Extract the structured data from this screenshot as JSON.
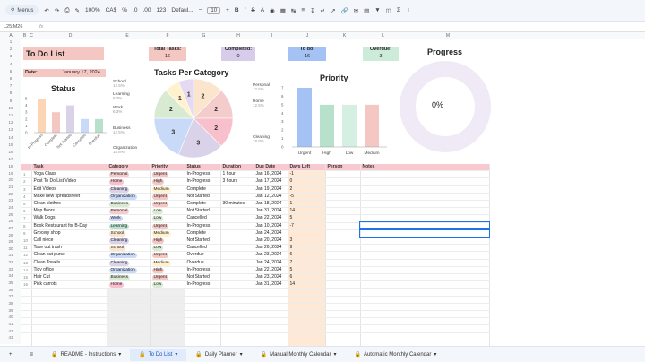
{
  "toolbar": {
    "menus": "Menus",
    "zoom": "100%",
    "currency": "CA$",
    "pct": "%",
    "dec": ".0",
    "dec2": ".00",
    "fmt": "123",
    "font": "Defaul...",
    "size": "10"
  },
  "formula_bar": {
    "cell_ref": "L25:M26",
    "fx": "fx"
  },
  "columns": [
    "A",
    "B",
    "C",
    "D",
    "E",
    "F",
    "G",
    "H",
    "I",
    "J",
    "K",
    "L",
    "M"
  ],
  "rows": [
    "1",
    "2",
    "3",
    "4",
    "5",
    "6",
    "7",
    "8",
    "9",
    "10",
    "11",
    "12",
    "13",
    "14",
    "15",
    "16",
    "17",
    "18",
    "19",
    "20",
    "21",
    "22",
    "23",
    "24",
    "25",
    "26",
    "27",
    "28",
    "29",
    "30",
    "31",
    "32",
    "33",
    "34",
    "35",
    "36",
    "37",
    "38",
    "39",
    "40",
    "41",
    "42",
    "43",
    "44",
    "45",
    "46",
    "47",
    "48",
    "49"
  ],
  "header": {
    "title": "To Do List",
    "date_label": "Date:",
    "date_value": "January 17, 2024"
  },
  "kpis": [
    {
      "label": "Total Tasks:",
      "value": "16",
      "color": "#f4c7c3"
    },
    {
      "label": "Completed:",
      "value": "0",
      "color": "#d7cdea"
    },
    {
      "label": "To do:",
      "value": "16",
      "color": "#a4c2f4"
    },
    {
      "label": "Overdue:",
      "value": "3",
      "color": "#cdebd9"
    }
  ],
  "status_chart": {
    "title": "Status",
    "yticks": [
      "5",
      "4",
      "3",
      "2",
      "1",
      "0"
    ],
    "categories": [
      "In-Progress",
      "Complete",
      "Not Started",
      "Cancelled",
      "Overdue"
    ],
    "values": [
      5,
      3,
      4,
      2,
      2
    ],
    "colors": [
      "#fcd5b4",
      "#f4c7c3",
      "#d9d2e9",
      "#c9daf8",
      "#b7e1cd"
    ]
  },
  "category_chart": {
    "title": "Tasks Per Category",
    "slices": [
      {
        "name": "School",
        "pct": "12.5%",
        "value": 2,
        "color": "#fce5cd"
      },
      {
        "name": "Personal",
        "pct": "12.5%",
        "value": 2,
        "color": "#f4cccc"
      },
      {
        "name": "Home",
        "pct": "12.5%",
        "value": 2,
        "color": "#f8c0cc"
      },
      {
        "name": "Cleaning",
        "pct": "18.8%",
        "value": 3,
        "color": "#d9d2e9"
      },
      {
        "name": "Organization",
        "pct": "18.8%",
        "value": 3,
        "color": "#c9daf8"
      },
      {
        "name": "Business",
        "pct": "12.5%",
        "value": 2,
        "color": "#d9ead3"
      },
      {
        "name": "Work",
        "pct": "6.3%",
        "value": 1,
        "color": "#fff2cc"
      },
      {
        "name": "Learning",
        "pct": "6.3%",
        "value": 1,
        "color": "#e6d9f2"
      }
    ]
  },
  "priority_chart": {
    "title": "Priority",
    "yticks": [
      "7",
      "6",
      "5",
      "4",
      "3",
      "2",
      "1",
      "0"
    ],
    "categories": [
      "Urgent",
      "High",
      "Low",
      "Medium"
    ],
    "values": [
      7,
      5,
      5,
      5
    ],
    "colors": [
      "#a4c2f4",
      "#b7e1cd",
      "#d5f0e3",
      "#f4c7c3"
    ]
  },
  "progress": {
    "title": "Progress",
    "value": "0%",
    "fraction": 0
  },
  "table": {
    "headers": [
      "Task",
      "Category",
      "Priority",
      "Status",
      "Duration",
      "Due Date",
      "Days Left",
      "Person",
      "Notes"
    ],
    "rows": [
      [
        "Yoga Class",
        "Personal",
        "Urgent",
        "In-Progress",
        "1 hour",
        "Jan 16, 2024",
        "-1",
        "",
        ""
      ],
      [
        "Post To Do List Video",
        "Home",
        "High",
        "In-Progress",
        "3 hours",
        "Jan 17, 2024",
        "0",
        "",
        ""
      ],
      [
        "Edit Videos",
        "Cleaning",
        "Medium",
        "Complete",
        "",
        "Jan 19, 2024",
        "2",
        "",
        ""
      ],
      [
        "Make new spreadsheet",
        "Organization",
        "Urgent",
        "Not Started",
        "",
        "Jan 12, 2024",
        "-5",
        "",
        ""
      ],
      [
        "Clean clothes",
        "Business",
        "Urgent",
        "Complete",
        "30 minutes",
        "Jan 18, 2024",
        "1",
        "",
        ""
      ],
      [
        "Mop floors",
        "Personal",
        "Low",
        "Not Started",
        "",
        "Jan 31, 2024",
        "14",
        "",
        ""
      ],
      [
        "Walk Dogs",
        "Work",
        "Low",
        "Cancelled",
        "",
        "Jan 22, 2024",
        "5",
        "",
        ""
      ],
      [
        "Book Restaurant for B-Day",
        "Learning",
        "Urgent",
        "In-Progress",
        "",
        "Jan 10, 2024",
        "-7",
        "",
        ""
      ],
      [
        "Grocery shop",
        "School",
        "Medium",
        "Complete",
        "",
        "Jan 24, 2024",
        "",
        "",
        ""
      ],
      [
        "Call niece",
        "Cleaning",
        "High",
        "Not Started",
        "",
        "Jan 20, 2024",
        "3",
        "",
        ""
      ],
      [
        "Take out trash",
        "School",
        "Low",
        "Cancelled",
        "",
        "Jan 26, 2024",
        "9",
        "",
        ""
      ],
      [
        "Clean out purse",
        "Organization",
        "Urgent",
        "Overdue",
        "",
        "Jan 23, 2024",
        "6",
        "",
        ""
      ],
      [
        "Clean Towels",
        "Cleaning",
        "Medium",
        "Overdue",
        "",
        "Jan 24, 2024",
        "7",
        "",
        ""
      ],
      [
        "Tidy office",
        "Organization",
        "High",
        "In-Progress",
        "",
        "Jan 22, 2024",
        "5",
        "",
        ""
      ],
      [
        "Hair Cut",
        "Business",
        "Urgent",
        "Not Started",
        "",
        "Jan 23, 2024",
        "6",
        "",
        ""
      ],
      [
        "Pick carrots",
        "Home",
        "Low",
        "In-Progress",
        "",
        "Jan 31, 2024",
        "14",
        "",
        ""
      ]
    ],
    "row_numbers": [
      "1",
      "2",
      "3",
      "4",
      "5",
      "6",
      "7",
      "8",
      "9",
      "10",
      "11",
      "12",
      "13",
      "14",
      "15",
      "16"
    ],
    "empty_rows": 9
  },
  "category_colors": {
    "Personal": "#f4cccc",
    "Home": "#f8c0cc",
    "Cleaning": "#d9d2e9",
    "Organization": "#c9daf8",
    "Business": "#d9ead3",
    "Work": "#c9daf8",
    "Learning": "#b7e1cd",
    "School": "#fce5cd"
  },
  "priority_colors": {
    "Urgent": "#f4c7c3",
    "High": "#f4c7c3",
    "Medium": "#fff2cc",
    "Low": "#d9ead3"
  },
  "tabs": [
    "README - Instructions",
    "To Do List",
    "Daily Planner",
    "Manual Monthly Calendar",
    "Automatic Monthly Calendar"
  ],
  "active_tab": 1
}
